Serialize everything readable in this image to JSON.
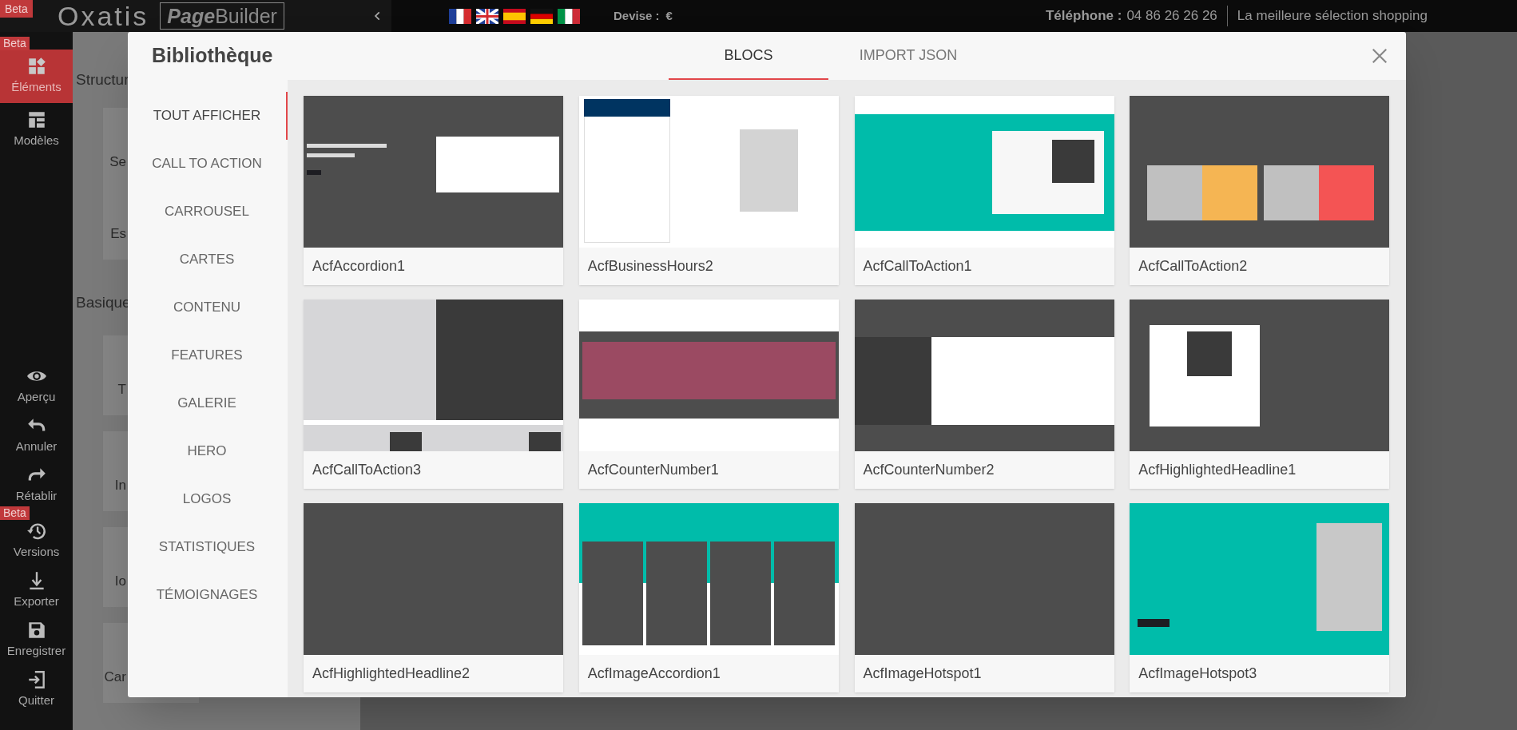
{
  "top_bar": {
    "beta_badge": "Beta",
    "logo": "Oxatis",
    "product": {
      "bold": "Page",
      "light": "Builder"
    },
    "flags": [
      {
        "kind": "fr"
      },
      {
        "kind": "uk"
      },
      {
        "kind": "es"
      },
      {
        "kind": "de"
      },
      {
        "kind": "it"
      }
    ],
    "currency_label": "Devise :",
    "currency": "€",
    "phone_label": "Téléphone :",
    "phone": "04 86 26 26 26",
    "tagline": "La meilleure sélection shopping"
  },
  "sidebar": {
    "items": [
      {
        "kind": "elements",
        "label": "Éléments",
        "selected": true,
        "badge": "Beta"
      },
      {
        "kind": "models",
        "label": "Modèles",
        "selected": false
      },
      {
        "kind": "preview",
        "label": "Aperçu",
        "selected": false
      },
      {
        "kind": "undo",
        "label": "Annuler",
        "selected": false
      },
      {
        "kind": "redo",
        "label": "Rétablir",
        "selected": false
      },
      {
        "kind": "versions",
        "label": "Versions",
        "selected": false,
        "badge": "Beta"
      },
      {
        "kind": "export",
        "label": "Exporter",
        "selected": false
      },
      {
        "kind": "save",
        "label": "Enregistrer",
        "selected": false
      },
      {
        "kind": "quit",
        "label": "Quitter",
        "selected": false
      }
    ]
  },
  "panel": {
    "section_1": "Structur",
    "tiles_1": [
      "Se",
      "Es"
    ],
    "section_2": "Basique",
    "tiles_2": [
      "T",
      "In",
      "Io",
      "Car"
    ]
  },
  "modal": {
    "title": "Bibliothèque",
    "tabs": [
      {
        "label": "BLOCS",
        "selected": true
      },
      {
        "label": "IMPORT JSON",
        "selected": false
      }
    ],
    "categories": [
      {
        "label": "TOUT AFFICHER",
        "selected": true
      },
      {
        "label": "CALL TO ACTION",
        "selected": false
      },
      {
        "label": "CARROUSEL",
        "selected": false
      },
      {
        "label": "CARTES",
        "selected": false
      },
      {
        "label": "CONTENU",
        "selected": false
      },
      {
        "label": "FEATURES",
        "selected": false
      },
      {
        "label": "GALERIE",
        "selected": false
      },
      {
        "label": "HERO",
        "selected": false
      },
      {
        "label": "LOGOS",
        "selected": false
      },
      {
        "label": "STATISTIQUES",
        "selected": false
      },
      {
        "label": "TÉMOIGNAGES",
        "selected": false
      }
    ],
    "blocks": [
      {
        "name": "AcfAccordion1",
        "kind": "panel"
      },
      {
        "name": "AcfBusinessHours2",
        "kind": "hours"
      },
      {
        "name": "AcfCallToAction1",
        "kind": "box"
      },
      {
        "name": "AcfCallToAction2",
        "kind": "cards"
      },
      {
        "name": "AcfCallToAction3",
        "kind": "split"
      },
      {
        "name": "AcfCounterNumber1",
        "kind": "counter"
      },
      {
        "name": "AcfCounterNumber2",
        "kind": "banner"
      },
      {
        "name": "AcfHighlightedHeadline1",
        "kind": "card"
      },
      {
        "name": "AcfHighlightedHeadline2",
        "kind": "plain"
      },
      {
        "name": "AcfImageAccordion1",
        "kind": "columns"
      },
      {
        "name": "AcfImageHotspot1",
        "kind": "plain"
      },
      {
        "name": "AcfImageHotspot3",
        "kind": "image"
      }
    ]
  }
}
